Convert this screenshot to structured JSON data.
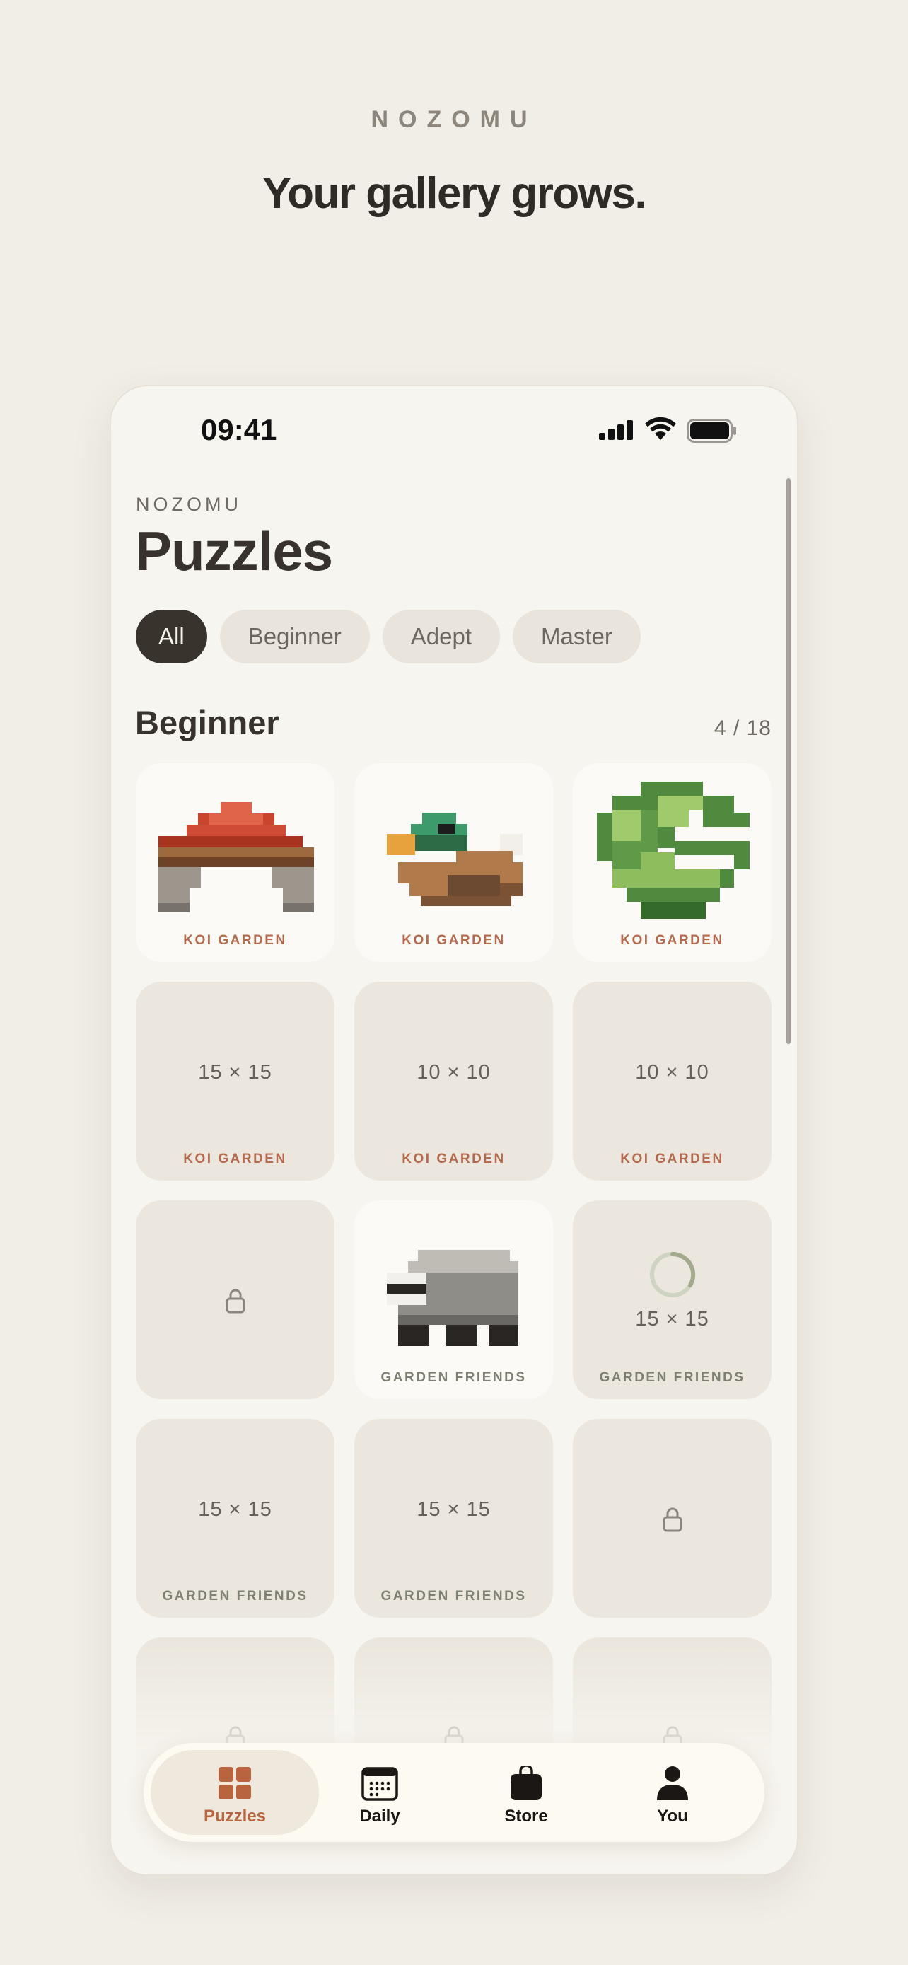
{
  "hero": {
    "brand": "NOZOMU",
    "headline": "Your gallery grows."
  },
  "status_bar": {
    "time": "09:41"
  },
  "header": {
    "app_label": "NOZOMU",
    "title": "Puzzles"
  },
  "filters": {
    "items": [
      "All",
      "Beginner",
      "Adept",
      "Master"
    ],
    "selected": "All"
  },
  "section": {
    "title": "Beginner",
    "count": "4 / 18"
  },
  "tiles": {
    "t1": {
      "caption": "KOI GARDEN",
      "state": "completed",
      "art": "bridge"
    },
    "t2": {
      "caption": "KOI GARDEN",
      "state": "completed",
      "art": "duck"
    },
    "t3": {
      "caption": "KOI GARDEN",
      "state": "completed",
      "art": "lily-pad"
    },
    "t4": {
      "size": "15 × 15",
      "caption": "KOI GARDEN",
      "state": "available"
    },
    "t5": {
      "size": "10 × 10",
      "caption": "KOI GARDEN",
      "state": "available"
    },
    "t6": {
      "size": "10 × 10",
      "caption": "KOI GARDEN",
      "state": "available"
    },
    "t7": {
      "state": "locked"
    },
    "t8": {
      "caption": "GARDEN FRIENDS",
      "state": "completed",
      "art": "badger"
    },
    "t9": {
      "size": "15 × 15",
      "caption": "GARDEN FRIENDS",
      "state": "in-progress"
    },
    "t10": {
      "size": "15 × 15",
      "caption": "GARDEN FRIENDS",
      "state": "available"
    },
    "t11": {
      "size": "15 × 15",
      "caption": "GARDEN FRIENDS",
      "state": "available"
    },
    "t12": {
      "state": "locked"
    },
    "t13": {
      "state": "locked"
    },
    "t14": {
      "state": "locked"
    },
    "t15": {
      "state": "locked"
    }
  },
  "tabbar": {
    "items": [
      {
        "label": "Puzzles",
        "icon": "grid-icon",
        "active": true
      },
      {
        "label": "Daily",
        "icon": "calendar-icon",
        "active": false
      },
      {
        "label": "Store",
        "icon": "bag-icon",
        "active": false
      },
      {
        "label": "You",
        "icon": "person-icon",
        "active": false
      }
    ]
  },
  "colors": {
    "background": "#f1eee7",
    "accent": "#b8643f",
    "chip_active": "#38332d",
    "koi_caption": "#b56a4e",
    "garden_caption": "#7d8072"
  }
}
